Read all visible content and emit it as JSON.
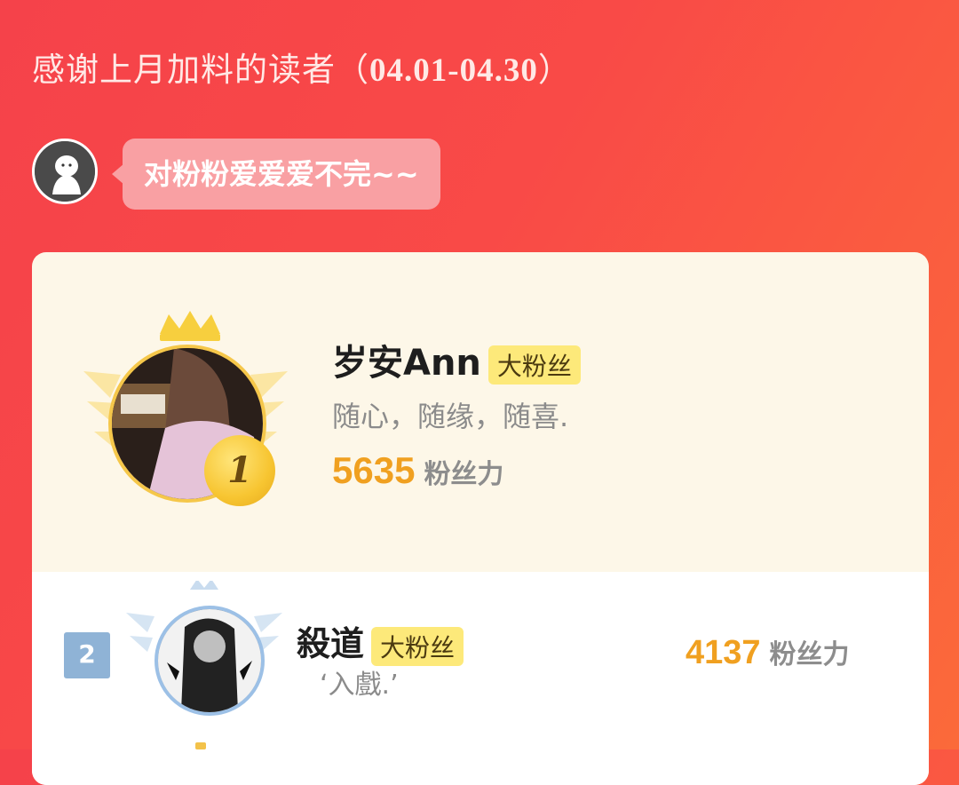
{
  "header": {
    "title_text": "感谢上月加料的读者（",
    "title_date": "04.01-04.30",
    "title_close": "）"
  },
  "author_message": {
    "text": "对粉粉爱爱爱不完~~"
  },
  "leaderboard": {
    "entries": [
      {
        "rank": "1",
        "name": "岁安Ann",
        "badge": "大粉丝",
        "signature": "随心，随缘，随喜.",
        "score": "5635",
        "score_unit": "粉丝力"
      },
      {
        "rank": "2",
        "name": "殺道",
        "badge": "大粉丝",
        "signature": "‘入戲.’",
        "score": "4137",
        "score_unit": "粉丝力"
      }
    ]
  },
  "colors": {
    "accent_gold": "#f0a020",
    "badge_yellow": "#fde97a",
    "rank2_blue": "#8fb3d6"
  }
}
